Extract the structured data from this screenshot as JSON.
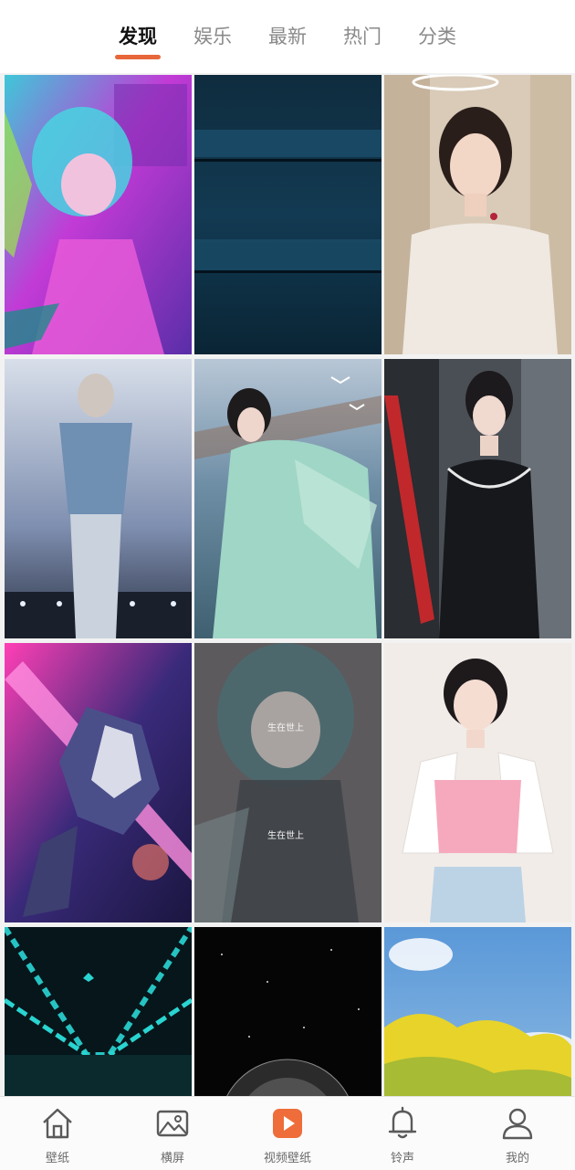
{
  "top_tabs": [
    {
      "label": "发现",
      "active": true
    },
    {
      "label": "娱乐",
      "active": false
    },
    {
      "label": "最新",
      "active": false
    },
    {
      "label": "热门",
      "active": false
    },
    {
      "label": "分类",
      "active": false
    }
  ],
  "accent_color": "#e8673a",
  "wallpapers": [
    {
      "subject": "anime girl neon"
    },
    {
      "subject": "dark blue abstract"
    },
    {
      "subject": "woman white dress"
    },
    {
      "subject": "singer on stage"
    },
    {
      "subject": "woman hanfu seagulls"
    },
    {
      "subject": "woman black dress"
    },
    {
      "subject": "gundam robot"
    },
    {
      "subject": "anime girl with text",
      "overlay_text": [
        "生在世上",
        "生在世上"
      ]
    },
    {
      "subject": "girl pink top"
    },
    {
      "subject": "teal tunnel"
    },
    {
      "subject": "moon starfield"
    },
    {
      "subject": "rapeseed field sky"
    }
  ],
  "bottom_nav": [
    {
      "label": "壁纸",
      "icon": "house-icon"
    },
    {
      "label": "横屏",
      "icon": "image-icon"
    },
    {
      "label": "视频壁纸",
      "icon": "play-icon"
    },
    {
      "label": "铃声",
      "icon": "bell-icon"
    },
    {
      "label": "我的",
      "icon": "user-icon"
    }
  ]
}
